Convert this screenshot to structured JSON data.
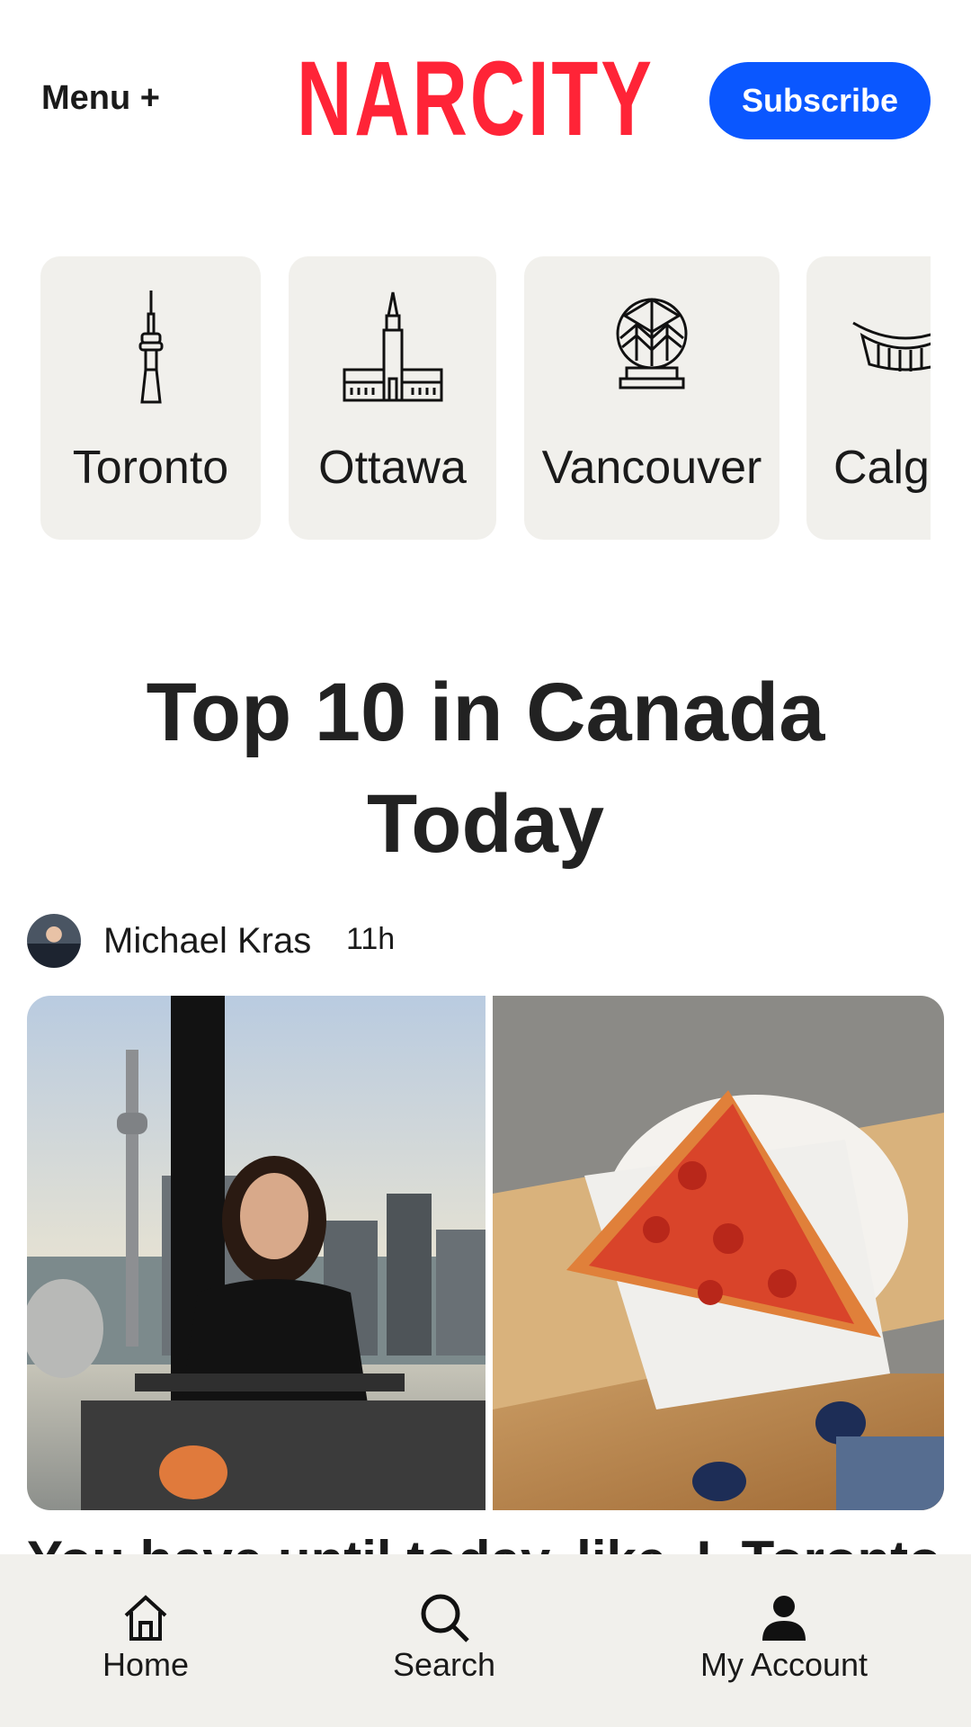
{
  "header": {
    "menu_label": "Menu +",
    "logo_text": "NARCITY",
    "subscribe_label": "Subscribe",
    "brand_color": "#ff2437",
    "accent_color": "#0a57ff"
  },
  "cities": [
    {
      "label": "Toronto",
      "icon": "cn-tower-icon"
    },
    {
      "label": "Ottawa",
      "icon": "parliament-icon"
    },
    {
      "label": "Vancouver",
      "icon": "science-world-dome-icon"
    },
    {
      "label": "Calg",
      "icon": "saddledome-icon"
    }
  ],
  "section": {
    "title_line1": "Top 10 in Canada",
    "title_line2": "Today"
  },
  "article": {
    "author": "Michael Kras",
    "time": "11h",
    "headline": "You have until today, like, I, Toronto"
  },
  "bottom_nav": [
    {
      "label": "Home",
      "icon": "home-icon"
    },
    {
      "label": "Search",
      "icon": "search-icon"
    },
    {
      "label": "My Account",
      "icon": "user-icon"
    }
  ]
}
